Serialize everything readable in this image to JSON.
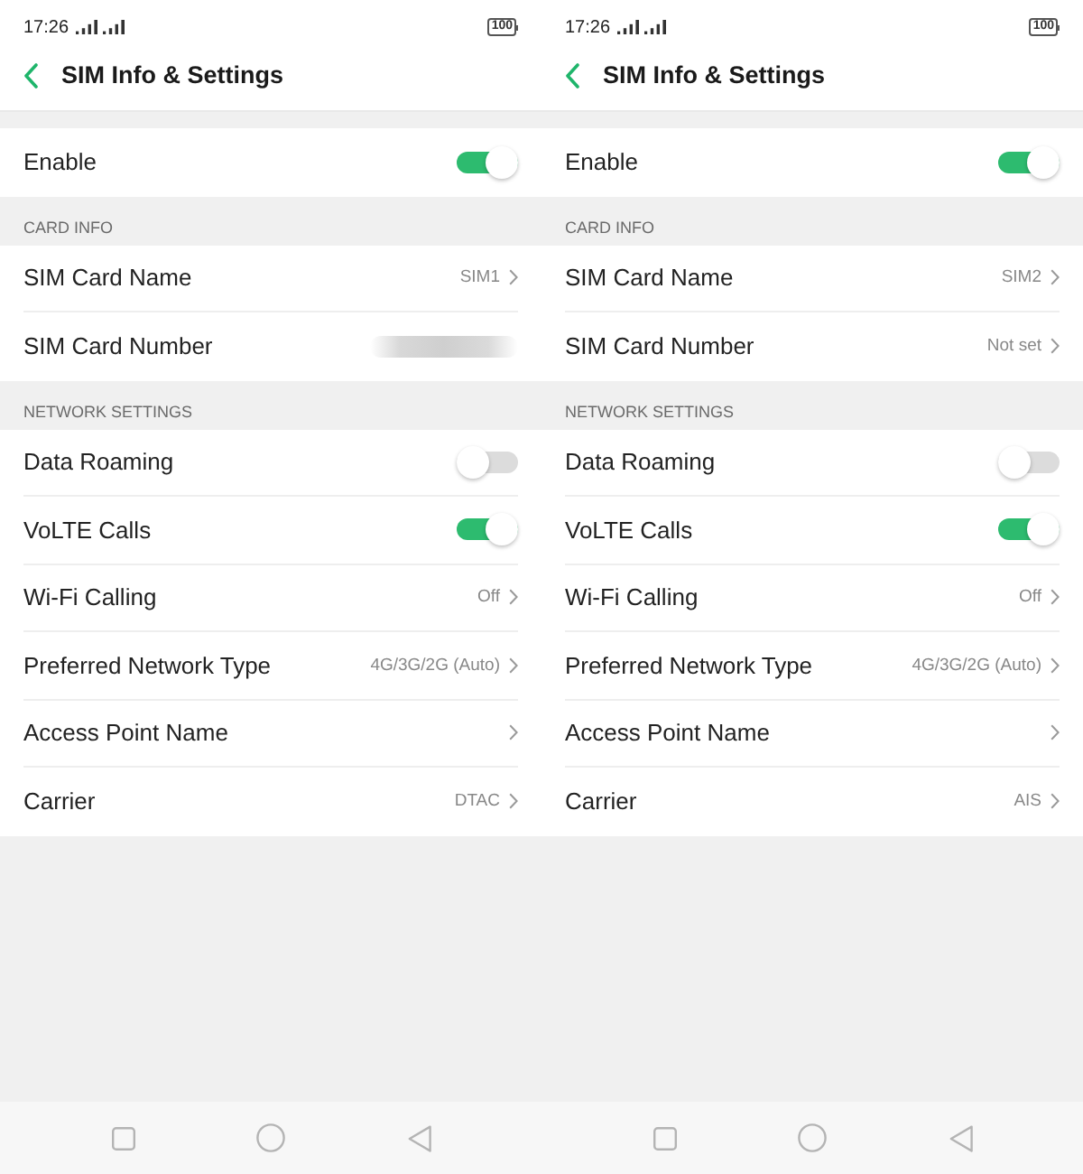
{
  "screens": [
    {
      "status_bar": {
        "time": "17:26",
        "battery": "100"
      },
      "header": {
        "title": "SIM Info & Settings"
      },
      "sections": [
        {
          "rows": [
            {
              "kind": "toggle",
              "label": "Enable",
              "on": true
            }
          ]
        },
        {
          "title": "CARD INFO",
          "rows": [
            {
              "kind": "link",
              "label": "SIM Card Name",
              "value": "SIM1"
            },
            {
              "kind": "blurred",
              "label": "SIM Card Number"
            }
          ]
        },
        {
          "title": "NETWORK SETTINGS",
          "rows": [
            {
              "kind": "toggle",
              "label": "Data Roaming",
              "on": false
            },
            {
              "kind": "toggle",
              "label": "VoLTE Calls",
              "on": true
            },
            {
              "kind": "link",
              "label": "Wi-Fi Calling",
              "value": "Off"
            },
            {
              "kind": "link",
              "label": "Preferred Network Type",
              "value": "4G/3G/2G (Auto)"
            },
            {
              "kind": "link",
              "label": "Access Point Name"
            },
            {
              "kind": "link",
              "label": "Carrier",
              "value": "DTAC"
            }
          ]
        }
      ]
    },
    {
      "status_bar": {
        "time": "17:26",
        "battery": "100"
      },
      "header": {
        "title": "SIM Info & Settings"
      },
      "sections": [
        {
          "rows": [
            {
              "kind": "toggle",
              "label": "Enable",
              "on": true
            }
          ]
        },
        {
          "title": "CARD INFO",
          "rows": [
            {
              "kind": "link",
              "label": "SIM Card Name",
              "value": "SIM2"
            },
            {
              "kind": "link",
              "label": "SIM Card Number",
              "value": "Not set"
            }
          ]
        },
        {
          "title": "NETWORK SETTINGS",
          "rows": [
            {
              "kind": "toggle",
              "label": "Data Roaming",
              "on": false
            },
            {
              "kind": "toggle",
              "label": "VoLTE Calls",
              "on": true
            },
            {
              "kind": "link",
              "label": "Wi-Fi Calling",
              "value": "Off"
            },
            {
              "kind": "link",
              "label": "Preferred Network Type",
              "value": "4G/3G/2G (Auto)"
            },
            {
              "kind": "link",
              "label": "Access Point Name"
            },
            {
              "kind": "link",
              "label": "Carrier",
              "value": "AIS"
            }
          ]
        }
      ]
    }
  ]
}
